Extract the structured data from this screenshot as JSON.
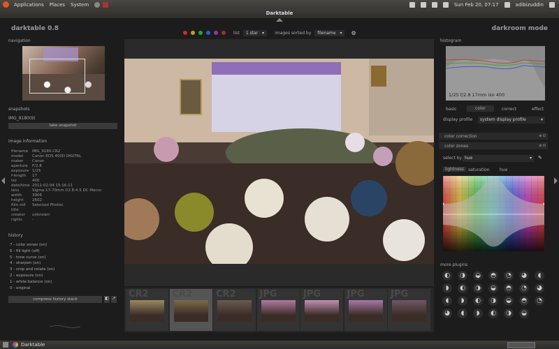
{
  "system_panel": {
    "menus": [
      "Applications",
      "Places",
      "System"
    ],
    "datetime": "Sun Feb 20, 07:17",
    "user": "adibizuddin"
  },
  "window": {
    "title": "Darktable"
  },
  "header": {
    "app_name": "darktable 0.8",
    "mode": "darkroom mode",
    "filter_view": "list",
    "filter_rating": "1 star",
    "sorted_label": "images sorted by",
    "sort_field": "filename",
    "color_labels": [
      "#c03030",
      "#c0a020",
      "#30a030",
      "#3060c0",
      "#a030a0",
      "#a03030"
    ]
  },
  "left": {
    "navigation_label": "navigation",
    "snapshots_label": "snapshots",
    "snapshot_item": "IMG_9180(9)",
    "take_snapshot": "take snapshot",
    "image_information_label": "image information",
    "info": [
      [
        "filename",
        "IMG_9180.CR2"
      ],
      [
        "model",
        "Canon EOS 400D DIGITAL"
      ],
      [
        "maker",
        "Canon"
      ],
      [
        "aperture",
        "F/2.8"
      ],
      [
        "exposure",
        "1/25"
      ],
      [
        "f-length",
        "17"
      ],
      [
        "iso",
        "400"
      ],
      [
        "date/time",
        "2011:02:04 15:16:11"
      ],
      [
        "lens",
        "Sigma 17-70mm f/2.8-4.5 DC Macro"
      ],
      [
        "width",
        "3906"
      ],
      [
        "height",
        "2602"
      ],
      [
        "film roll",
        "Selected Photos"
      ],
      [
        "title",
        ""
      ],
      [
        "creator",
        "unknown"
      ],
      [
        "rights",
        "-"
      ]
    ],
    "history_label": "history",
    "history": [
      "7 - color zones (on)",
      "6 - fill light (off)",
      "5 - tone curve (on)",
      "4 - sharpen (on)",
      "3 - crop and rotate (on)",
      "2 - exposure (on)",
      "1 - white balance (on)",
      "0 - original"
    ],
    "compress_history": "compress history stack"
  },
  "filmstrip": {
    "thumbs": [
      {
        "ext": "CR2",
        "color": "#9a8a60"
      },
      {
        "ext": "CR2",
        "color": "#7a6a4a"
      },
      {
        "ext": "CR2",
        "color": "#6a5a50"
      },
      {
        "ext": "JPG",
        "color": "#b07aa0"
      },
      {
        "ext": "JPG",
        "color": "#c090b0"
      },
      {
        "ext": "JPG",
        "color": "#a878a8"
      },
      {
        "ext": "JPG",
        "color": "#705868"
      }
    ]
  },
  "right": {
    "histogram_label": "histogram",
    "exif_summary": "1/25 f/2.8 17mm iso 400",
    "tabs": [
      "basic",
      "color",
      "correct",
      "effect"
    ],
    "display_profile_label": "display profile",
    "display_profile_value": "system display profile",
    "color_correction": "color correction",
    "color_zones": "color zones",
    "select_by_label": "select by",
    "select_by_value": "hue",
    "zone_tabs": [
      "lightness",
      "saturation",
      "hue"
    ],
    "more_plugins": "more plugins"
  },
  "taskbar": {
    "task": "Darktable"
  }
}
